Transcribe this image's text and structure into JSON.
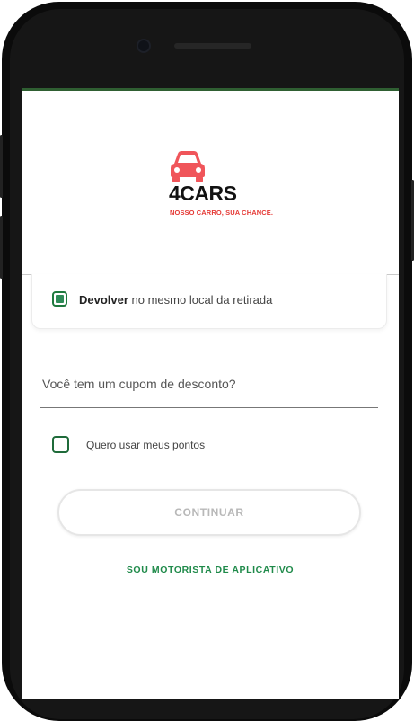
{
  "brand": {
    "name": "4CARS",
    "tagline": "NOSSO CARRO, SUA CHANCE.",
    "logo_icon": "car-icon",
    "logo_color": "#f0555a",
    "tagline_color": "#e53935"
  },
  "return_option": {
    "checked": true,
    "label_bold": "Devolver",
    "label_rest": " no mesmo local da retirada"
  },
  "coupon": {
    "placeholder": "Você tem um cupom de desconto?",
    "value": ""
  },
  "points_option": {
    "checked": false,
    "label": "Quero usar meus pontos"
  },
  "continue_button": {
    "label": "CONTINUAR"
  },
  "driver_link": {
    "label": "SOU MOTORISTA DE APLICATIVO"
  },
  "colors": {
    "accent_green": "#1f8a4a",
    "brand_red": "#e53935"
  }
}
